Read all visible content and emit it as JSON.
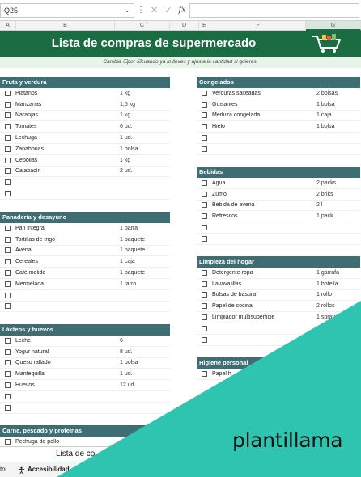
{
  "formula_bar": {
    "name_box": "Q25",
    "dots": "⋮",
    "cancel": "✕",
    "confirm": "✓",
    "fx": "fx"
  },
  "columns": [
    "A",
    "B",
    "C",
    "D",
    "E",
    "F",
    "G"
  ],
  "title": "Lista de compras de supermercado",
  "subtitle": "Cambia ☐por ☑cuando ya lo lleves y ajusta la cantidad si quieres.",
  "sections": [
    {
      "id": "fruta",
      "title": "Fruta y verdura",
      "items": [
        {
          "name": "Plátanos",
          "qty": "1 kg"
        },
        {
          "name": "Manzanas",
          "qty": "1,5 kg"
        },
        {
          "name": "Naranjas",
          "qty": "1 kg"
        },
        {
          "name": "Tomates",
          "qty": "6 ud."
        },
        {
          "name": "Lechuga",
          "qty": "1 ud."
        },
        {
          "name": "Zanahorias",
          "qty": "1 bolsa"
        },
        {
          "name": "Cebollas",
          "qty": "1 kg"
        },
        {
          "name": "Calabacín",
          "qty": "2 ud."
        },
        {
          "name": "",
          "qty": ""
        },
        {
          "name": "",
          "qty": ""
        }
      ]
    },
    {
      "id": "panaderia",
      "title": "Panadería y desayuno",
      "items": [
        {
          "name": "Pan integral",
          "qty": "1 barra"
        },
        {
          "name": "Tortillas de trigo",
          "qty": "1 paquete"
        },
        {
          "name": "Avena",
          "qty": "1 paquete"
        },
        {
          "name": "Cereales",
          "qty": "1 caja"
        },
        {
          "name": "Café molido",
          "qty": "1 paquete"
        },
        {
          "name": "Mermelada",
          "qty": "1 tarro"
        },
        {
          "name": "",
          "qty": ""
        },
        {
          "name": "",
          "qty": ""
        }
      ]
    },
    {
      "id": "lacteos",
      "title": "Lácteos y huevos",
      "items": [
        {
          "name": "Leche",
          "qty": "6 l"
        },
        {
          "name": "Yogur natural",
          "qty": "8 ud."
        },
        {
          "name": "Queso rallado",
          "qty": "1 bolsa"
        },
        {
          "name": "Mantequilla",
          "qty": "1 ud."
        },
        {
          "name": "Huevos",
          "qty": "12 ud."
        },
        {
          "name": "",
          "qty": ""
        },
        {
          "name": "",
          "qty": ""
        }
      ]
    },
    {
      "id": "carne",
      "title": "Carne, pescado y proteínas",
      "items": [
        {
          "name": "Pechuga de pollo",
          "qty": ""
        }
      ]
    },
    {
      "id": "congelados",
      "title": "Congelados",
      "items": [
        {
          "name": "Verduras salteadas",
          "qty": "2 bolsas"
        },
        {
          "name": "Guisantes",
          "qty": "1 bolsa"
        },
        {
          "name": "Merluza congelada",
          "qty": "1 caja"
        },
        {
          "name": "Hielo",
          "qty": "1 bolsa"
        },
        {
          "name": "",
          "qty": ""
        },
        {
          "name": "",
          "qty": ""
        }
      ]
    },
    {
      "id": "bebidas",
      "title": "Bebidas",
      "items": [
        {
          "name": "Agua",
          "qty": "2 packs"
        },
        {
          "name": "Zumo",
          "qty": "2 briks"
        },
        {
          "name": "Bebida de avena",
          "qty": "2 l"
        },
        {
          "name": "Refrescos",
          "qty": "1 pack"
        },
        {
          "name": "",
          "qty": ""
        },
        {
          "name": "",
          "qty": ""
        }
      ]
    },
    {
      "id": "limpieza",
      "title": "Limpieza del hogar",
      "items": [
        {
          "name": "Detergente ropa",
          "qty": "1 garrafa"
        },
        {
          "name": "Lavavajillas",
          "qty": "1 botella"
        },
        {
          "name": "Bolsas de basura",
          "qty": "1 rollo"
        },
        {
          "name": "Papel de cocina",
          "qty": "2 rollos"
        },
        {
          "name": "Limpiador multisuperficie",
          "qty": "1 spray"
        },
        {
          "name": "",
          "qty": ""
        },
        {
          "name": "",
          "qty": ""
        }
      ]
    },
    {
      "id": "higiene",
      "title": "Higiene personal",
      "items": [
        {
          "name": "Papel h",
          "qty": ""
        }
      ]
    }
  ],
  "sheet_tab": "Lista de co",
  "status": {
    "left": "to",
    "accessibility": "Accesibilidad"
  },
  "brand": "plantillama",
  "colors": {
    "green": "#1b6b43",
    "section": "#3e6e73",
    "teal": "#2ec4b0",
    "subtitle_bg": "#e8f3ea"
  }
}
